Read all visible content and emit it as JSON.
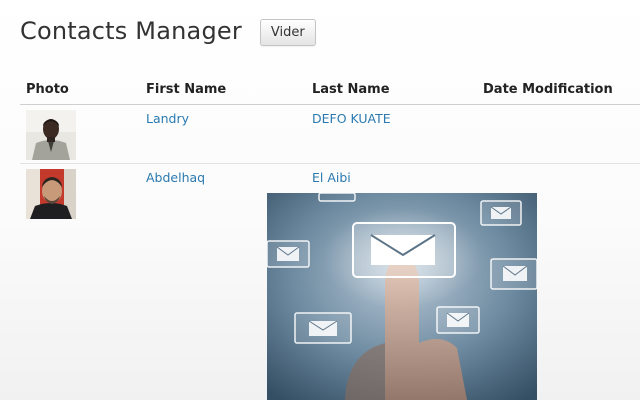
{
  "header": {
    "title": "Contacts Manager",
    "clear_button_label": "Vider"
  },
  "table": {
    "columns": [
      "Photo",
      "First Name",
      "Last Name",
      "Date Modification"
    ],
    "rows": [
      {
        "photo": "avatar-photo",
        "first_name": "Landry",
        "last_name": "DEFO KUATE",
        "date_modification": ""
      },
      {
        "photo": "avatar-photo",
        "first_name": "Abdelhaq",
        "last_name": "El Aibi",
        "date_modification": ""
      }
    ]
  },
  "illustration": {
    "icon": "email-envelope-touch-image"
  },
  "colors": {
    "link": "#2a7ab0",
    "title": "#333333"
  }
}
